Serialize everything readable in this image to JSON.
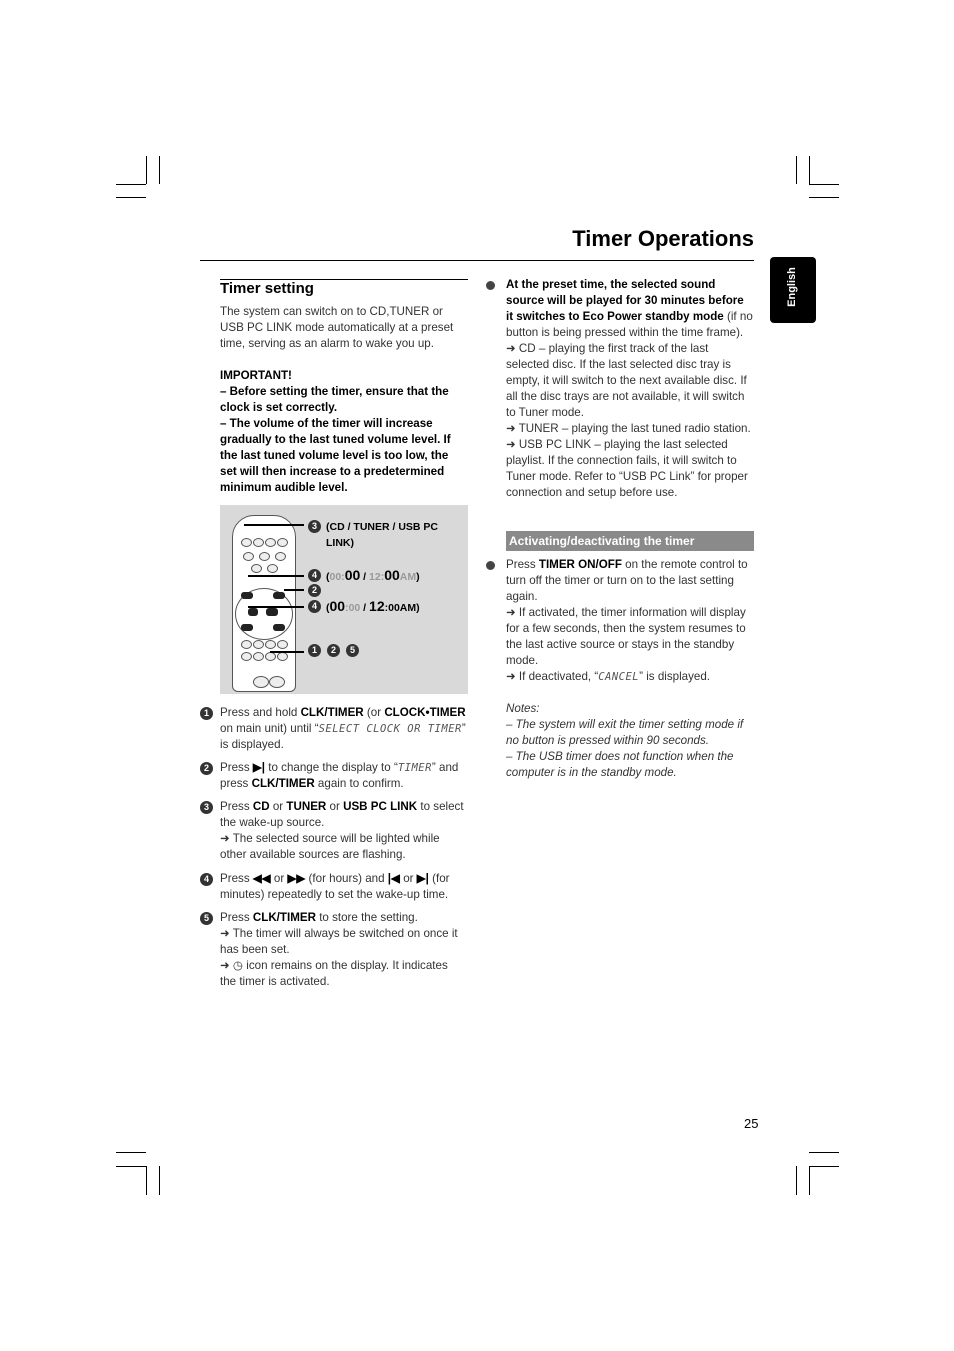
{
  "header": {
    "title": "Timer Operations",
    "language_tab": "English",
    "page_number": "25"
  },
  "left": {
    "section_title": "Timer setting",
    "intro": [
      {
        "t": "The system can switch on to CD,TUNER or USB PC LINK mode automatically at a preset time, serving as an alarm to wake you up."
      }
    ],
    "important_label": "IMPORTANT!",
    "important_1": [
      {
        "t": "–  Before setting the timer, ensure that the clock is set correctly.",
        "c": "b"
      }
    ],
    "important_2": [
      {
        "t": "–  The volume of the timer will increase gradually to the last tuned volume level. If the last tuned volume level is too low, the set will then increase to a predetermined minimum audible level.",
        "c": "b"
      }
    ],
    "figure": {
      "callout_3": [
        {
          "t": "(CD / TUNER / USB PC LINK)",
          "c": "b"
        }
      ],
      "callout_4a": [
        {
          "t": "(",
          "c": "b"
        },
        {
          "t": "00:",
          "c": "b g"
        },
        {
          "t": "00",
          "c": "big"
        },
        {
          "t": " / ",
          "c": "b"
        },
        {
          "t": "12:",
          "c": "b g"
        },
        {
          "t": "00",
          "c": "big"
        },
        {
          "t": "AM",
          "c": "b g"
        },
        {
          "t": ")",
          "c": "b"
        }
      ],
      "callout_4b": [
        {
          "t": "(",
          "c": "b"
        },
        {
          "t": "00",
          "c": "big"
        },
        {
          "t": ":00",
          "c": "b g"
        },
        {
          "t": " / ",
          "c": "b"
        },
        {
          "t": "12",
          "c": "big"
        },
        {
          "t": ":00AM",
          "c": "b"
        },
        {
          "t": ")",
          "c": "b"
        }
      ],
      "markers": [
        "4",
        "2",
        "4",
        "1",
        "2",
        "5",
        "3"
      ]
    },
    "steps": [
      {
        "num": "1",
        "runs": [
          {
            "t": "Press and hold "
          },
          {
            "t": "CLK/TIMER",
            "c": "b"
          },
          {
            "t": " (or "
          },
          {
            "t": "CLOCK•TIMER",
            "c": "b"
          },
          {
            "t": " on main unit) until “"
          },
          {
            "t": "SELECT CLOCK OR TIMER",
            "c": "s"
          },
          {
            "t": "” is displayed."
          }
        ]
      },
      {
        "num": "2",
        "runs": [
          {
            "t": "Press "
          },
          {
            "t": "▶|",
            "c": "b"
          },
          {
            "t": " to change the display to “"
          },
          {
            "t": "TIMER",
            "c": "s"
          },
          {
            "t": "” and press "
          },
          {
            "t": "CLK/TIMER",
            "c": "b"
          },
          {
            "t": " again to confirm."
          }
        ]
      },
      {
        "num": "3",
        "runs": [
          {
            "t": "Press "
          },
          {
            "t": "CD",
            "c": "b"
          },
          {
            "t": " or "
          },
          {
            "t": "TUNER",
            "c": "b"
          },
          {
            "t": " or "
          },
          {
            "t": "USB PC LINK",
            "c": "b"
          },
          {
            "t": " to select the wake-up source."
          },
          {
            "t": "\n➜ The selected source will be lighted while other available sources are flashing."
          }
        ]
      },
      {
        "num": "4",
        "runs": [
          {
            "t": "Press "
          },
          {
            "t": "◀◀",
            "c": "b"
          },
          {
            "t": " or "
          },
          {
            "t": "▶▶",
            "c": "b"
          },
          {
            "t": " (for hours) and "
          },
          {
            "t": "|◀",
            "c": "b"
          },
          {
            "t": " or "
          },
          {
            "t": "▶|",
            "c": "b"
          },
          {
            "t": " (for minutes) repeatedly to set the wake-up time."
          }
        ]
      },
      {
        "num": "5",
        "runs": [
          {
            "t": "Press "
          },
          {
            "t": "CLK/TIMER",
            "c": "b"
          },
          {
            "t": " to store the setting."
          },
          {
            "t": "\n➜ The timer will always be switched on once it has been set."
          },
          {
            "t": "\n➜ ◷ icon remains on the display. It indicates the timer is activated."
          }
        ]
      }
    ]
  },
  "right": {
    "bullet_1": [
      {
        "t": "At the preset time, the selected sound source will be played for 30 minutes before it switches to Eco Power standby mode",
        "c": "b"
      },
      {
        "t": " (if no button is being pressed within the time frame)."
      },
      {
        "t": "\n➜ CD – playing the first track of the last selected disc.  If the last selected disc tray is empty, it will switch to the next available disc.  If all the disc trays are not available, it will switch to Tuner mode."
      },
      {
        "t": "\n➜ TUNER – playing the last tuned radio station."
      },
      {
        "t": "\n➜ USB PC LINK – playing the last selected playlist.  If the connection fails, it will switch to Tuner mode.  Refer to “USB PC Link” for proper connection and setup before use."
      }
    ],
    "subsection_title": "Activating/deactivating the timer",
    "bullet_2": [
      {
        "t": "Press "
      },
      {
        "t": "TIMER ON/OFF",
        "c": "b"
      },
      {
        "t": " on the remote control to turn off the timer or turn on to the last setting again."
      },
      {
        "t": "\n➜ If activated, the timer information will display for a few seconds, then the system resumes to the last active source or stays in the standby mode."
      },
      {
        "t": "\n➜ If deactivated, “"
      },
      {
        "t": "CANCEL",
        "c": "s"
      },
      {
        "t": "” is displayed."
      }
    ],
    "notes_label": "Notes:",
    "notes": [
      [
        {
          "t": "–  The system will exit the timer setting mode if no button is pressed within 90 seconds.",
          "c": "i"
        }
      ],
      [
        {
          "t": "–  The USB timer does not function when the computer is in the standby mode.",
          "c": "i"
        }
      ]
    ]
  }
}
